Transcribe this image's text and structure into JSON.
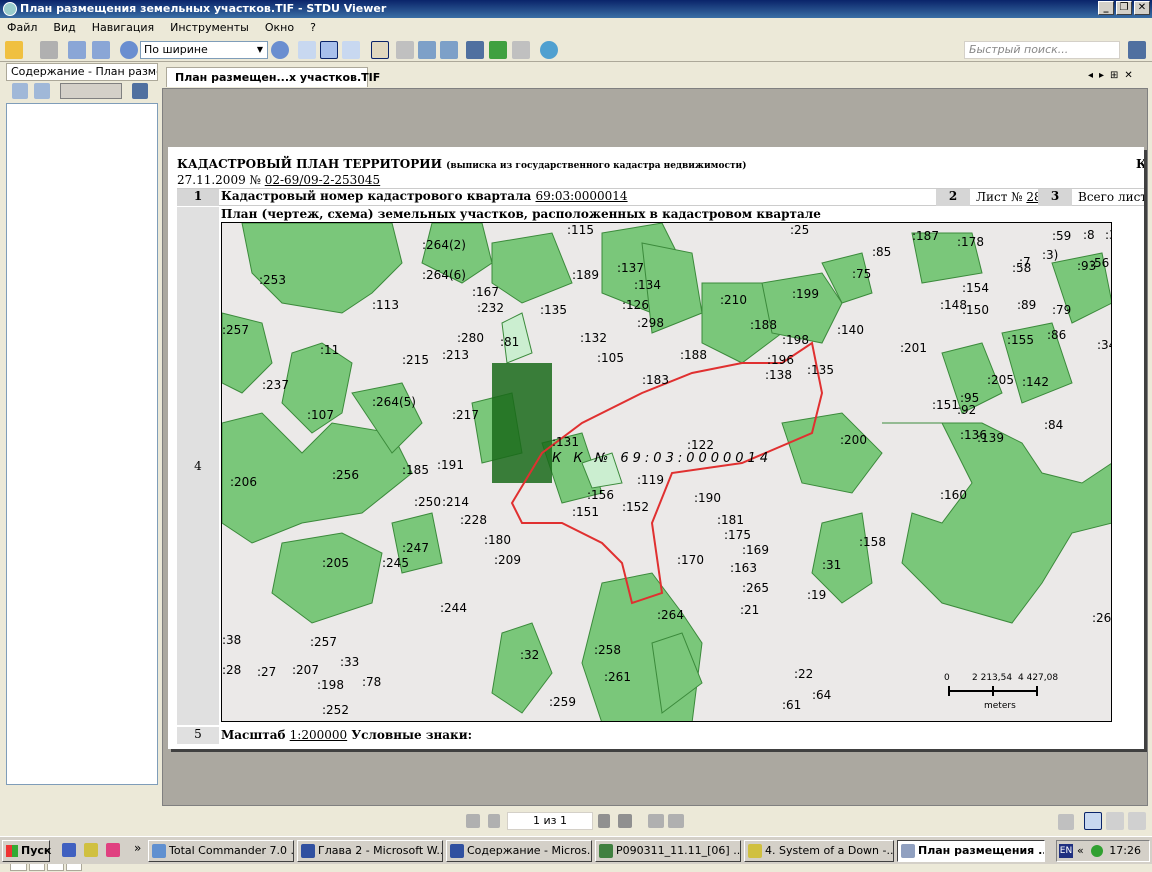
{
  "window": {
    "title": "План размещения земельных участков.TIF - STDU Viewer",
    "min": "_",
    "max": "❐",
    "close": "✕"
  },
  "menu": [
    "Файл",
    "Вид",
    "Навигация",
    "Инструменты",
    "Окно",
    "?"
  ],
  "toolbar": {
    "zoom_mode": "По ширине",
    "search_placeholder": "Быстрый поиск..."
  },
  "left_panel": {
    "title": "Содержание - План размещения",
    "tabs": [
      "С",
      "З",
      "З",
      "Г"
    ]
  },
  "doc_tab": "План размещен...х участков.TIF",
  "document": {
    "heading": "КАДАСТРОВЫЙ ПЛАН ТЕРРИТОРИИ",
    "heading_note": "(выписка из государственного кадастра недвижимости)",
    "right_letter": "К",
    "date": "27.11.2009 №",
    "number": "02-69/09-2-253045",
    "row1_num": "1",
    "quarter_label": "Кадастровый номер кадастрового квартала",
    "quarter_value": "69:03:0000014",
    "sheet_num": "2",
    "sheet_label": "Лист №",
    "sheet_value": "28",
    "total_num": "3",
    "total_label": "Всего листо",
    "plan_title": "План (чертеж, схема) земельных участков, расположенных в кадастровом квартале",
    "row4_num": "4",
    "row5_num": "5",
    "scale_label": "Масштаб",
    "scale_value": "1:200000",
    "legend_label": "Условные знаки:"
  },
  "map": {
    "kk_label": "К К № 69:03:0000014",
    "scale_ticks": [
      "0",
      "2 213,54",
      "4 427,08"
    ],
    "scale_unit": "meters",
    "labels": [
      ":264(2)",
      ":264(6)",
      ":253",
      ":113",
      ":257",
      ":232",
      ":167",
      ":11",
      ":215",
      ":213",
      ":81",
      ":280",
      ":237",
      ":264(5)",
      ":107",
      ":217",
      ":206",
      ":256",
      ":191",
      ":185",
      ":250",
      ":214",
      ":228",
      ":180",
      ":247",
      ":245",
      ":205",
      ":209",
      ":244",
      ":115",
      ":189",
      ":137",
      ":134",
      ":126",
      ":298",
      ":135",
      ":132",
      ":105",
      ":188",
      ":183",
      ":131",
      ":122",
      ":119",
      ":152",
      ":151",
      ":156",
      ":190",
      ":181",
      ":175",
      ":169",
      ":170",
      ":163",
      ":265",
      ":264",
      ":21",
      ":25",
      ":210",
      ":188",
      ":199",
      ":198",
      ":196",
      ":138",
      ":135",
      ":140",
      ":201",
      ":178",
      ":187",
      ":75",
      ":85",
      ":154",
      ":148",
      ":150",
      ":58",
      ":89",
      ":79",
      ":86",
      ":84",
      ":93",
      ":56",
      ":34",
      ":155",
      ":205",
      ":142",
      ":95",
      ":92",
      ":136",
      ":151",
      ":139",
      ":200",
      ":160",
      ":158",
      ":31",
      ":19",
      ":26",
      ":38",
      ":28",
      ":27",
      ":207",
      ":198",
      ":252",
      ":257",
      ":33",
      ":78",
      ":32",
      ":258",
      ":261",
      ":259",
      ":22",
      ":64",
      ":61",
      ":59",
      ":3)",
      ":7",
      ":8",
      ":37"
    ]
  },
  "pager": {
    "value": "1 из 1"
  },
  "taskbar": {
    "start": "Пуск",
    "items": [
      "Total Commander 7.0 ...",
      "Глава 2 - Microsoft W...",
      "Содержание - Micros...",
      "P090311_11.11_[06] ...",
      "4. System of a Down -...",
      "План размещения ..."
    ],
    "lang": "EN",
    "time": "17:26"
  }
}
